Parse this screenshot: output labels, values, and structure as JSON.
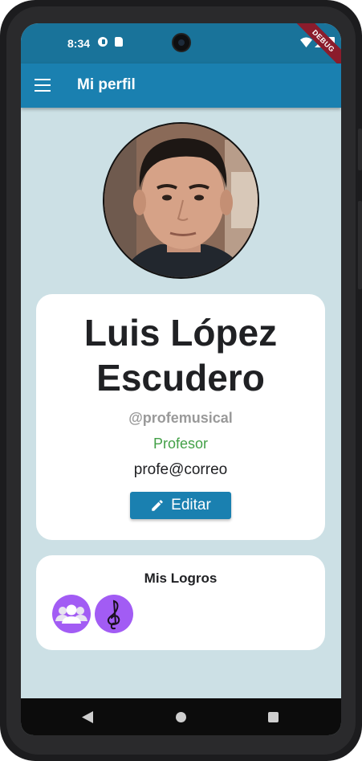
{
  "status_bar": {
    "time": "8:34",
    "icons": [
      "g-icon",
      "sd-card-icon",
      "wifi-icon",
      "signal-icon",
      "battery-icon"
    ]
  },
  "debug_banner": "DEBUG",
  "app_bar": {
    "title": "Mi perfil",
    "menu_icon": "menu-icon"
  },
  "profile": {
    "name_line1": "Luis López",
    "name_line2": "Escudero",
    "username": "@profemusical",
    "role": "Profesor",
    "email": "profe@correo",
    "edit_label": "Editar"
  },
  "achievements": {
    "title": "Mis Logros",
    "badges": [
      "group-icon",
      "treble-clef-icon"
    ]
  },
  "colors": {
    "primary": "#1a80b0",
    "status_bar": "#19739a",
    "background": "#cce0e5",
    "role": "#43a047",
    "username": "#9a9a9a",
    "badge": "#a25cf4"
  }
}
